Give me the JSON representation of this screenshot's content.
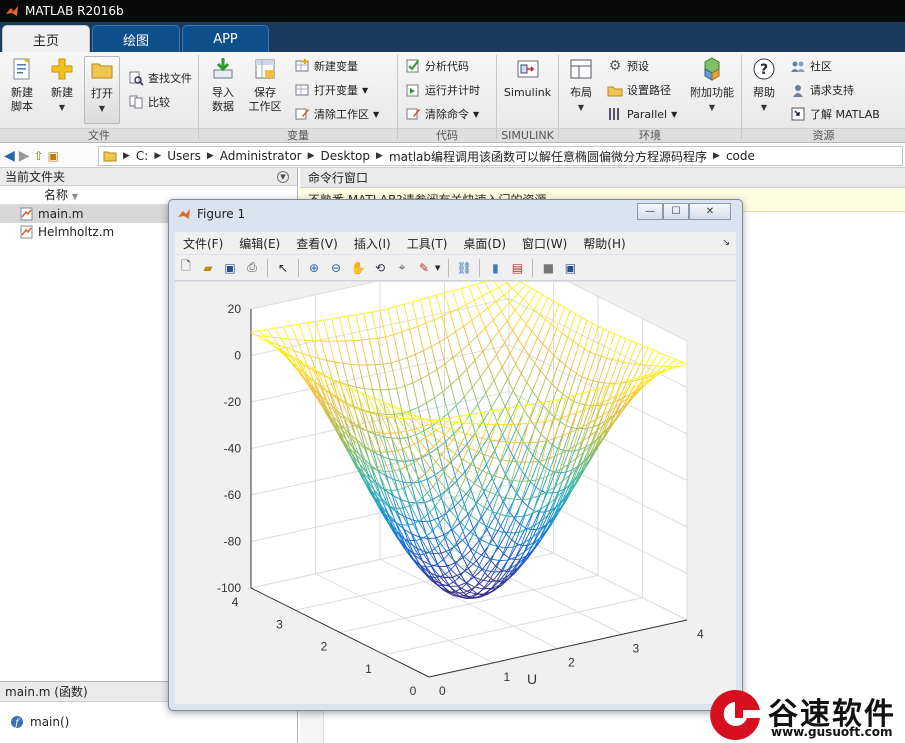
{
  "window": {
    "title": "MATLAB R2016b"
  },
  "tabs": [
    {
      "label": "主页",
      "active": true
    },
    {
      "label": "绘图",
      "active": false
    },
    {
      "label": "APP",
      "active": false
    }
  ],
  "ribbon": {
    "file": {
      "group": "文件",
      "new_script": "新建\n脚本",
      "new": "新建",
      "open": "打开",
      "find_files": "查找文件",
      "compare": "比较"
    },
    "variable": {
      "group": "变量",
      "import": "导入\n数据",
      "save_ws": "保存\n工作区",
      "new_var": "新建变量",
      "open_var": "打开变量",
      "clear_ws": "清除工作区"
    },
    "code": {
      "group": "代码",
      "analyze": "分析代码",
      "run_time": "运行并计时",
      "clear_cmd": "清除命令"
    },
    "simulink": {
      "group": "SIMULINK",
      "label": "Simulink"
    },
    "env": {
      "group": "环境",
      "layout": "布局",
      "prefs": "预设",
      "set_path": "设置路径",
      "parallel": "Parallel",
      "addons": "附加功能"
    },
    "resources": {
      "group": "资源",
      "help": "帮助",
      "community": "社区",
      "support": "请求支持",
      "learn": "了解 MATLAB"
    }
  },
  "address": {
    "crumbs": [
      "C:",
      "Users",
      "Administrator",
      "Desktop",
      "matlab编程调用该函数可以解任意椭圆偏微分方程源码程序",
      "code"
    ]
  },
  "current_folder": {
    "title": "当前文件夹",
    "col_name": "名称",
    "files": [
      "main.m",
      "Helmholtz.m"
    ],
    "details_title": "main.m  (函数)",
    "details_item": "main()"
  },
  "command_window": {
    "title": "命令行窗口",
    "notice": "不熟悉 MATLAB?请参阅有关快速入门的资源。"
  },
  "figure": {
    "title": "Figure 1",
    "menu": [
      "文件(F)",
      "编辑(E)",
      "查看(V)",
      "插入(I)",
      "工具(T)",
      "桌面(D)",
      "窗口(W)",
      "帮助(H)"
    ],
    "buttons": {
      "minimize": "—",
      "maximize": "☐",
      "close": "✕"
    }
  },
  "chart_data": {
    "type": "surface",
    "xlabel": "U",
    "ylabel": "",
    "zlabel": "",
    "xlim": [
      0,
      4
    ],
    "ylim": [
      0,
      4
    ],
    "zlim": [
      -100,
      20
    ],
    "x_ticks": [
      0,
      1,
      2,
      3,
      4
    ],
    "y_ticks": [
      0,
      1,
      2,
      3,
      4
    ],
    "z_ticks": [
      -100,
      -80,
      -60,
      -40,
      -20,
      0,
      20
    ],
    "z_min": -91,
    "z_max": 10,
    "colormap": "parula",
    "grid": true
  },
  "watermark": {
    "name": "谷速软件",
    "url": "www.gusuoft.com"
  }
}
